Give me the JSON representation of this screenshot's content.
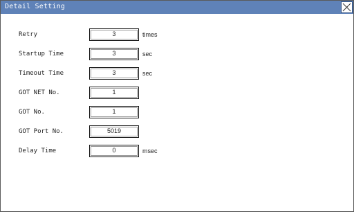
{
  "window": {
    "title": "Detail Setting",
    "close_icon": "close-x-icon"
  },
  "fields": [
    {
      "label": "Retry",
      "value": "3",
      "unit": "times"
    },
    {
      "label": "Startup Time",
      "value": "3",
      "unit": "sec"
    },
    {
      "label": "Timeout Time",
      "value": "3",
      "unit": "sec"
    },
    {
      "label": "GOT NET No.",
      "value": "1",
      "unit": ""
    },
    {
      "label": "GOT No.",
      "value": "1",
      "unit": ""
    },
    {
      "label": "GOT Port No.",
      "value": "5019",
      "unit": ""
    },
    {
      "label": "Delay Time",
      "value": "0",
      "unit": "msec"
    }
  ],
  "colors": {
    "titlebar": "#5f82b8",
    "title_text": "#ffffff",
    "background": "#ffffff"
  }
}
